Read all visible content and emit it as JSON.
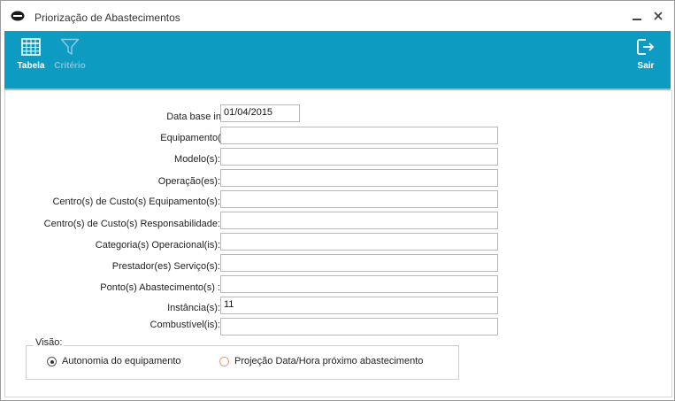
{
  "window": {
    "title": "Priorização de Abastecimentos"
  },
  "toolbar": {
    "tabela_label": "Tabela",
    "criterio_label": "Critério",
    "sair_label": "Sair",
    "background": "#0e9bc2"
  },
  "form": {
    "data_base_label": "Data base inicial:",
    "data_base_value": "01/04/2015",
    "fields": [
      {
        "label": "Equipamento(s):",
        "value": ""
      },
      {
        "label": "Modelo(s):",
        "value": ""
      },
      {
        "label": "Operação(es):",
        "value": ""
      },
      {
        "label": "Centro(s) de Custo(s) Equipamento(s):",
        "value": ""
      },
      {
        "label": "Centro(s) de Custo(s) Responsabilidade:",
        "value": ""
      },
      {
        "label": "Categoria(s) Operacional(is):",
        "value": ""
      },
      {
        "label": "Prestador(es) Serviço(s):",
        "value": ""
      },
      {
        "label": "Ponto(s) Abastecimento(s) :",
        "value": ""
      },
      {
        "label": "Instância(s):",
        "value": "11"
      },
      {
        "label": "Combustível(is):",
        "value": ""
      }
    ]
  },
  "visao": {
    "title": "Visão:",
    "options": [
      {
        "label": "Autonomia do equipamento",
        "selected": true
      },
      {
        "label": "Projeção Data/Hora próximo abastecimento",
        "selected": false
      }
    ]
  }
}
